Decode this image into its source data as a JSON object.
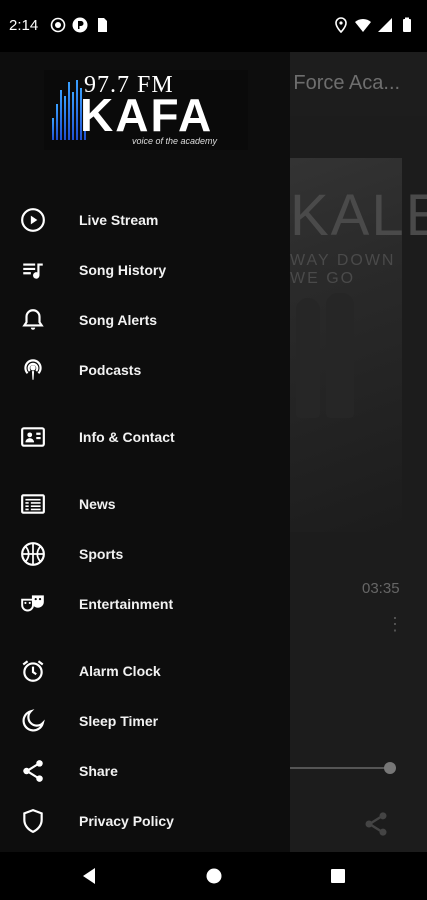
{
  "status_bar": {
    "time": "2:14",
    "left_icons": [
      "record-icon",
      "p-badge-icon",
      "sim-card-icon"
    ],
    "right_icons": [
      "location-icon",
      "wifi-icon",
      "signal-icon",
      "battery-icon"
    ]
  },
  "background_app": {
    "title": "S. Air Force Aca...",
    "album_artist_text": "KALEO",
    "album_subtitle_text": "WAY DOWN WE GO",
    "duration": "03:35",
    "song_title": "Way Down We Go",
    "artist": "Kaleo"
  },
  "drawer": {
    "logo": {
      "frequency": "97.7 FM",
      "call_sign": "KAFA",
      "tagline": "voice of the academy"
    },
    "items": [
      {
        "label": "Live Stream",
        "icon": "play-circle-icon"
      },
      {
        "label": "Song History",
        "icon": "playlist-icon"
      },
      {
        "label": "Song Alerts",
        "icon": "bell-icon"
      },
      {
        "label": "Podcasts",
        "icon": "podcast-icon"
      },
      {
        "label": "Info & Contact",
        "icon": "contact-card-icon"
      },
      {
        "label": "News",
        "icon": "newspaper-icon"
      },
      {
        "label": "Sports",
        "icon": "basketball-icon"
      },
      {
        "label": "Entertainment",
        "icon": "theater-masks-icon"
      },
      {
        "label": "Alarm Clock",
        "icon": "alarm-clock-icon"
      },
      {
        "label": "Sleep Timer",
        "icon": "moon-icon"
      },
      {
        "label": "Share",
        "icon": "share-icon"
      },
      {
        "label": "Privacy Policy",
        "icon": "shield-icon"
      }
    ]
  },
  "nav_bar": {
    "buttons": [
      "back-icon",
      "home-icon",
      "recents-icon"
    ]
  }
}
